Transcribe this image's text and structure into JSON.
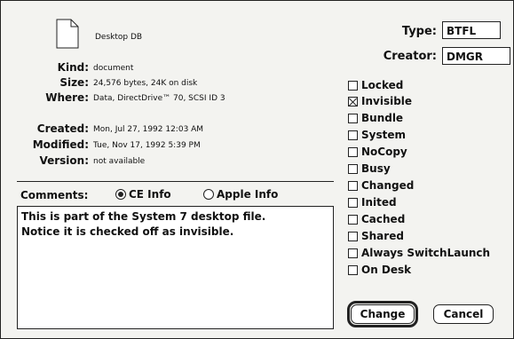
{
  "file": {
    "name": "Desktop DB"
  },
  "info": {
    "kind_label": "Kind:",
    "kind_value": "document",
    "size_label": "Size:",
    "size_value": "24,576 bytes, 24K on disk",
    "where_label": "Where:",
    "where_value": "Data, DirectDrive™ 70, SCSI ID 3",
    "created_label": "Created:",
    "created_value": "Mon, Jul 27, 1992 12:03 AM",
    "modified_label": "Modified:",
    "modified_value": "Tue, Nov 17, 1992 5:39 PM",
    "version_label": "Version:",
    "version_value": "not available"
  },
  "type_creator": {
    "type_label": "Type:",
    "type_value": "BTFL",
    "creator_label": "Creator:",
    "creator_value": "DMGR"
  },
  "flags": [
    {
      "label": "Locked",
      "checked": false
    },
    {
      "label": "Invisible",
      "checked": true
    },
    {
      "label": "Bundle",
      "checked": false
    },
    {
      "label": "System",
      "checked": false
    },
    {
      "label": "NoCopy",
      "checked": false
    },
    {
      "label": "Busy",
      "checked": false
    },
    {
      "label": "Changed",
      "checked": false
    },
    {
      "label": "Inited",
      "checked": false
    },
    {
      "label": "Cached",
      "checked": false
    },
    {
      "label": "Shared",
      "checked": false
    },
    {
      "label": "Always SwitchLaunch",
      "checked": false
    },
    {
      "label": "On Desk",
      "checked": false
    }
  ],
  "comments": {
    "label": "Comments:",
    "option_ce": "CE Info",
    "option_apple": "Apple Info",
    "selected": "CE Info",
    "text": "This is part of the System 7 desktop file.\nNotice it is checked off as invisible."
  },
  "buttons": {
    "change": "Change",
    "cancel": "Cancel"
  }
}
